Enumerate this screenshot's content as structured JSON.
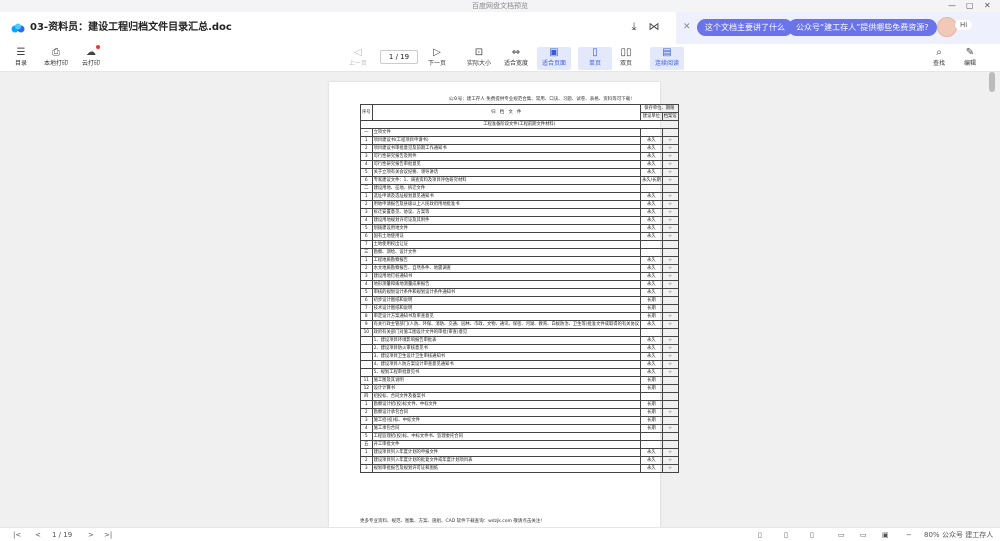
{
  "window": {
    "title": "百度网盘文档预览"
  },
  "header": {
    "doc_title": "03-资料员：建设工程归档文件目录汇总.doc"
  },
  "ai": {
    "chip1": "这个文档主要讲了什么",
    "chip2": "公众号“建工存人”提供哪些免费资源?",
    "hi": "Hi"
  },
  "toolbar": {
    "catalog": "目录",
    "local_print": "本地打印",
    "cloud_print": "云打印",
    "prev": "上一页",
    "page": "1 / 19",
    "next": "下一页",
    "actual": "实际大小",
    "fit_width": "适合宽度",
    "fit_page": "适合页面",
    "single": "单页",
    "double": "双页",
    "continuous": "连续阅读",
    "find": "查找",
    "edit": "编辑"
  },
  "doc": {
    "note": "公众号：建工存人 免费提供专业规范合集、常用、口诀、习题、试卷、表格、资料等可下载!",
    "head": {
      "seq": "序号",
      "title": "归　档　文　件",
      "period": "保存单位、期限",
      "unit": "建设单位",
      "archive": "档案馆"
    },
    "section_title": "工程准备阶段文件(工程前期文件材料)",
    "rows": [
      [
        "一",
        "立项文件",
        "",
        ""
      ],
      [
        "1",
        "项目建议书(工程项目申请书)",
        "永久",
        "☆"
      ],
      [
        "2",
        "项目建议书审批意见及前期工作通知书",
        "永久",
        "☆"
      ],
      [
        "3",
        "可行性研究报告及附件",
        "永久",
        "☆"
      ],
      [
        "4",
        "可行性研究报告审批意见",
        "永久",
        "☆"
      ],
      [
        "5",
        "关于立项有关会议纪要、领导讲话",
        "永久",
        "☆"
      ],
      [
        "6",
        "专家建议文件：1、调查资料及项目评估研究材料",
        "永久/长期",
        "☆"
      ],
      [
        "二",
        "建设用地、征地、拆迁文件",
        "",
        ""
      ],
      [
        "1",
        "选址申请及选址规划意见通知书",
        "永久",
        "☆"
      ],
      [
        "2",
        "用地申请报告及县级以上人民政府用地批准书",
        "永久",
        "☆"
      ],
      [
        "3",
        "拆迁安置意见、协议、方案等",
        "永久",
        "☆"
      ],
      [
        "4",
        "建设用地规划许可证及其附件",
        "永久",
        "☆"
      ],
      [
        "5",
        "划拨建设用地文件",
        "永久",
        "☆"
      ],
      [
        "6",
        "国有土地使用证",
        "永久",
        "☆"
      ],
      [
        "7",
        "土地使用权出让证",
        "",
        ""
      ],
      [
        "三",
        "勘察、测绘、设计文件",
        "",
        ""
      ],
      [
        "1",
        "工程地质勘察报告",
        "永久",
        "☆"
      ],
      [
        "2",
        "水文地质勘察报告、自然条件、地震调查",
        "永久",
        "☆"
      ],
      [
        "3",
        "建设用地钉桩通知书",
        "永久",
        "☆"
      ],
      [
        "4",
        "地形测量和拨地测量成果报告",
        "永久",
        "☆"
      ],
      [
        "5",
        "审核的规划设计条件和规划设计条件通知书",
        "永久",
        "☆"
      ],
      [
        "6",
        "初步设计图纸和说明",
        "长期",
        ""
      ],
      [
        "7",
        "技术设计图纸和说明",
        "长期",
        ""
      ],
      [
        "8",
        "审定设计方案通知书及审查意见",
        "长期",
        "☆"
      ],
      [
        "9",
        "有关行政主管部门(人防、环保、消防、交通、园林、市政、文物、通讯、保密、河湖、教育、白蚁防治、卫生等)批准文件或取得的有关协议",
        "永久",
        "☆"
      ],
      [
        "10",
        "政府有关部门对施工图设计文件的审批(审查)意见",
        "",
        ""
      ],
      [
        "",
        "1、建设项目环境影响报告审批表",
        "永久",
        "☆"
      ],
      [
        "",
        "2、建设项目防火审核意见书",
        "永久",
        "☆"
      ],
      [
        "",
        "3、建设项目卫生设计卫生审核通知书",
        "永久",
        "☆"
      ],
      [
        "",
        "4、建设项目人防方案设计审查意见通知书",
        "永久",
        "☆"
      ],
      [
        "",
        "5、规划工程审批意见书",
        "永久",
        "☆"
      ],
      [
        "11",
        "施工图及其说明",
        "长期",
        ""
      ],
      [
        "12",
        "设计计算书",
        "长期",
        ""
      ],
      [
        "四",
        "招投标、合同文件及备案书",
        "",
        ""
      ],
      [
        "1",
        "勘察设计招(投)标文件、中标文件",
        "长期",
        ""
      ],
      [
        "2",
        "勘察设计承包合同",
        "长期",
        "☆"
      ],
      [
        "3",
        "施工招(投)标、中标文件",
        "长期",
        ""
      ],
      [
        "4",
        "施工承包合同",
        "长期",
        "☆"
      ],
      [
        "5",
        "工程监理招(投)标、中标文件书、监理委托合同",
        "",
        ""
      ],
      [
        "五",
        "开工审批文件",
        "",
        ""
      ],
      [
        "1",
        "建设项目列入年度计划的申报文件",
        "永久",
        "☆"
      ],
      [
        "2",
        "建设项目列入年度计划的批复文件或年度计划项目表",
        "永久",
        "☆"
      ],
      [
        "3",
        "规划审批报告及规划许可证和图纸",
        "永久",
        "☆"
      ]
    ],
    "footer": "更多专业资料、规范、图集、方案、施组、CAD 软件下载查询：wdzjk.com 敬请点击关注!"
  },
  "bottom": {
    "page": "1 / 19",
    "zoom": "80%",
    "wm": "公众号 建工存人"
  }
}
